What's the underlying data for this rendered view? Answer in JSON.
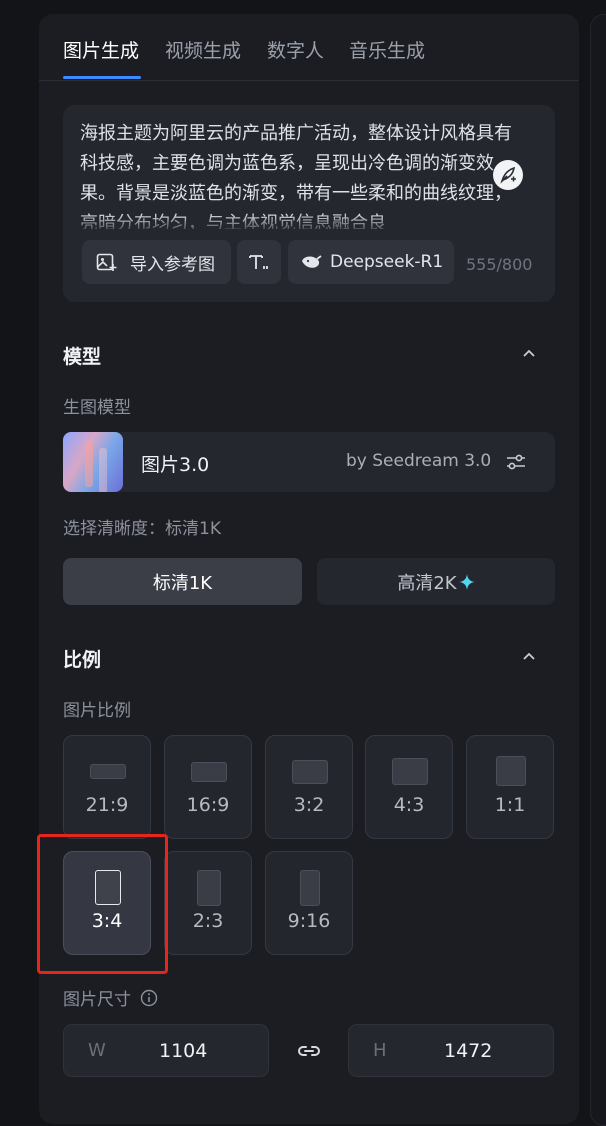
{
  "tabs": [
    {
      "label": "图片生成",
      "active": true
    },
    {
      "label": "视频生成",
      "active": false
    },
    {
      "label": "数字人",
      "active": false
    },
    {
      "label": "音乐生成",
      "active": false
    }
  ],
  "prompt": {
    "text": "海报主题为阿里云的产品推广活动，整体设计风格具有科技感，主要色调为蓝色系，呈现出冷色调的渐变效果。背景是淡蓝色的渐变，带有一些柔和的曲线纹理，亮暗分布均匀，与主体视觉信息融合良",
    "import_label": "导入参考图",
    "text_tool_icon": "text-format-icon",
    "model_chip_label": "Deepseek-R1",
    "counter": "555/800"
  },
  "model_section": {
    "title": "模型",
    "sub_label": "生图模型",
    "model_name": "图片3.0",
    "model_by": "by Seedream 3.0",
    "resolution_label": "选择清晰度：标清1K",
    "resolution_options": [
      {
        "label": "标清1K",
        "selected": true
      },
      {
        "label": "高清2K",
        "selected": false,
        "icon": "sparkle-icon"
      }
    ]
  },
  "ratio_section": {
    "title": "比例",
    "sub_label": "图片比例",
    "options": [
      {
        "label": "21:9",
        "selected": false
      },
      {
        "label": "16:9",
        "selected": false
      },
      {
        "label": "3:2",
        "selected": false
      },
      {
        "label": "4:3",
        "selected": false
      },
      {
        "label": "1:1",
        "selected": false
      },
      {
        "label": "3:4",
        "selected": true
      },
      {
        "label": "2:3",
        "selected": false
      },
      {
        "label": "9:16",
        "selected": false
      }
    ]
  },
  "size_section": {
    "label": "图片尺寸",
    "width_axis": "W",
    "width_value": "1104",
    "height_axis": "H",
    "height_value": "1472"
  },
  "colors": {
    "accent": "#3d8bff",
    "sparkle": "#4fd7f0",
    "highlight": "#e8251a"
  }
}
